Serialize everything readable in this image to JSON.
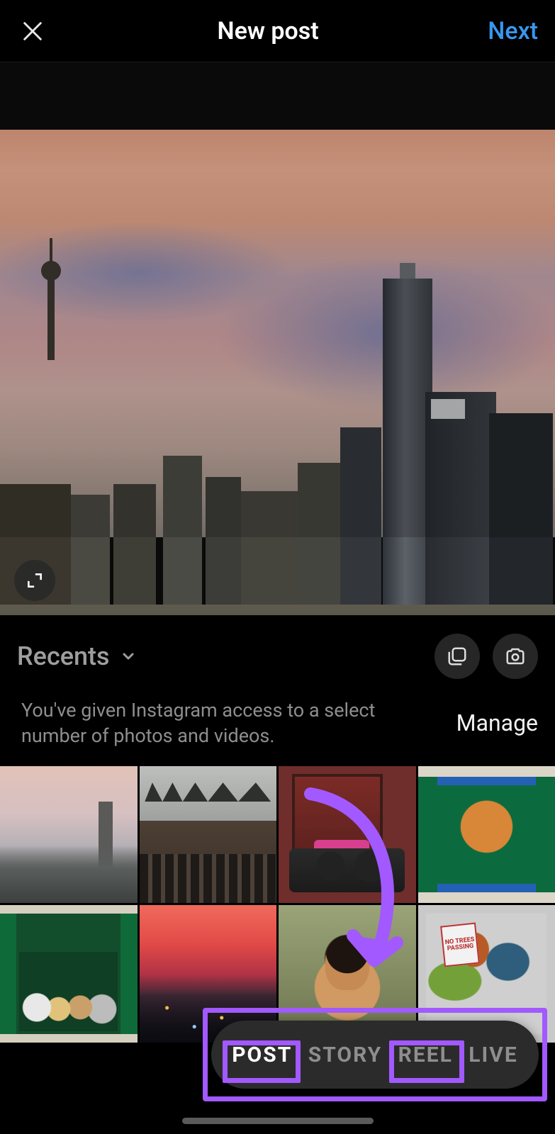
{
  "header": {
    "title": "New post",
    "next_label": "Next"
  },
  "album": {
    "label": "Recents"
  },
  "permission": {
    "text": "You've given Instagram access to a select number of photos and videos.",
    "manage_label": "Manage"
  },
  "tabs": {
    "items": [
      {
        "label": "POST",
        "active": true
      },
      {
        "label": "STORY",
        "active": false
      },
      {
        "label": "REEL",
        "active": false
      },
      {
        "label": "LIVE",
        "active": false
      }
    ]
  },
  "thumbnails": {
    "sign_text": "NO TREES PASSING"
  },
  "colors": {
    "accent_link": "#3897f0",
    "annotation": "#a259ff"
  }
}
